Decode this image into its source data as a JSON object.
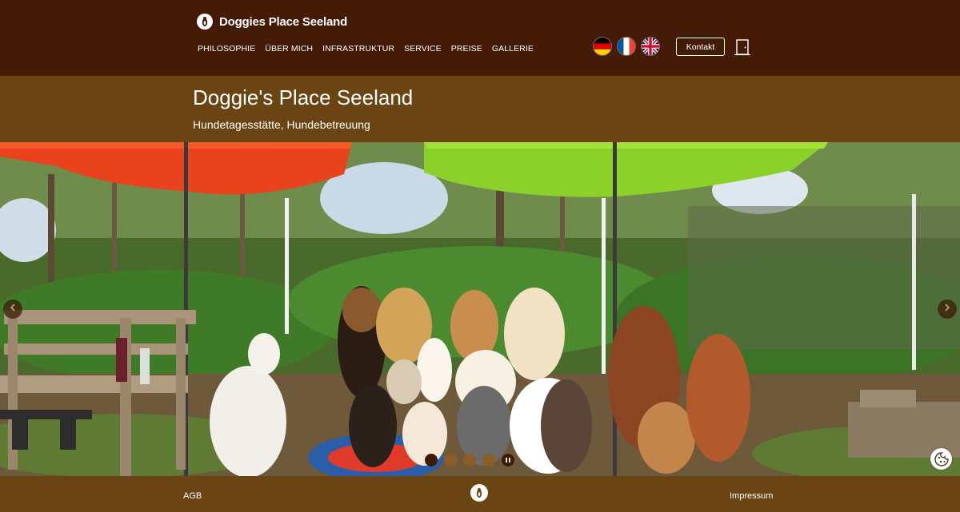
{
  "header": {
    "brand_name": "Doggies Place Seeland",
    "nav": [
      {
        "label": "PHILOSOPHIE"
      },
      {
        "label": "ÜBER MICH"
      },
      {
        "label": "INFRASTRUKTUR"
      },
      {
        "label": "SERVICE"
      },
      {
        "label": "PREISE"
      },
      {
        "label": "GALLERIE"
      }
    ],
    "languages": [
      {
        "code": "de",
        "icon": "flag-germany-icon"
      },
      {
        "code": "fr",
        "icon": "flag-france-icon"
      },
      {
        "code": "en",
        "icon": "flag-uk-icon"
      }
    ],
    "contact_label": "Kontakt",
    "login_icon": "door-icon"
  },
  "hero": {
    "title": "Doggie's Place Seeland",
    "subtitle": "Hundetagesstätte, Hundebetreuung"
  },
  "slider": {
    "slide_count": 4,
    "active_slide": 1,
    "icons": {
      "prev": "chevron-left-icon",
      "next": "chevron-right-icon",
      "pause": "pause-icon",
      "cookie": "cookie-icon"
    }
  },
  "footer": {
    "agb_label": "AGB",
    "impressum_label": "Impressum",
    "logo_icon": "dog-logo-icon"
  },
  "colors": {
    "header_bg": "#431b06",
    "title_bar_bg": "#6a4412",
    "footer_bg": "#6a4412",
    "dot_active": "#3e1c04",
    "dot_inactive": "#8a5e26",
    "text": "#ffffff"
  }
}
